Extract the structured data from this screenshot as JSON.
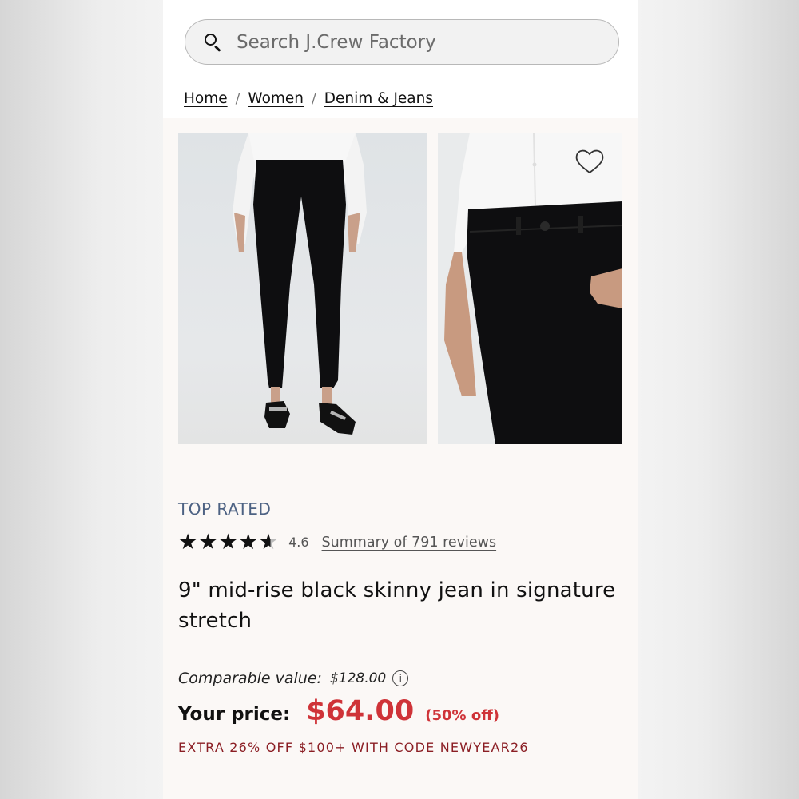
{
  "search": {
    "placeholder": "Search J.Crew Factory"
  },
  "breadcrumb": {
    "items": [
      "Home",
      "Women",
      "Denim & Jeans"
    ],
    "separator": "/"
  },
  "product": {
    "badge": "TOP RATED",
    "rating_value": "4.6",
    "rating_stars": 4.6,
    "reviews_link": "Summary of 791 reviews",
    "title": "9\" mid-rise black skinny jean in signature stretch",
    "comparable_label": "Comparable value:",
    "comparable_price": "$128.00",
    "your_price_label": "Your price:",
    "price": "$64.00",
    "discount": "(50% off)",
    "promo": "EXTRA 26% OFF $100+ WITH CODE NEWYEAR26"
  },
  "icons": {
    "search": "search-icon",
    "wishlist": "heart-icon",
    "info": "info-icon",
    "star": "star-icon"
  },
  "colors": {
    "badge": "#4d6283",
    "sale_price": "#cf3338",
    "promo": "#8b1e24",
    "content_bg": "#fbf8f6"
  }
}
